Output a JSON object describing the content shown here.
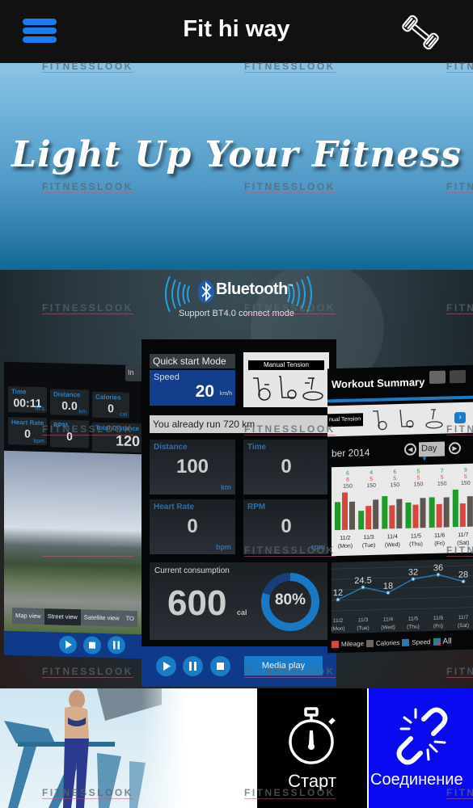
{
  "header": {
    "title": "Fit hi way",
    "menu_icon": "hamburger-menu-icon",
    "right_icon": "dumbbell-icon",
    "accent_color": "#1a7cf0"
  },
  "hero": {
    "slogan": "Light Up Your Fitness"
  },
  "promo": {
    "bluetooth_label": "Bluetooth",
    "bluetooth_tm": "™",
    "bluetooth_subtitle": "Support BT4.0 connect mode",
    "left_screen": {
      "top_button_partial": "In",
      "metrics": [
        {
          "label": "Time",
          "value": "00:11",
          "unit": "m:s"
        },
        {
          "label": "Distance",
          "value": "0.0",
          "unit": "km"
        },
        {
          "label": "Calories",
          "value": "0",
          "unit": "cal"
        },
        {
          "label": "Heart Rate",
          "value": "0",
          "unit": "bpm"
        },
        {
          "label": "RPM",
          "value": "0",
          "unit": ""
        },
        {
          "label": "Total Distance",
          "value": "120",
          "unit": ""
        }
      ],
      "view_tabs": [
        {
          "label": "Map view",
          "active": false
        },
        {
          "label": "Street view",
          "active": true
        },
        {
          "label": "Satellite view",
          "active": false
        },
        {
          "label": "TO",
          "active": false
        }
      ],
      "controls": [
        "play-icon",
        "stop-icon",
        "pause-icon"
      ]
    },
    "center_screen": {
      "mode_label": "Quick start Mode",
      "speed_label": "Speed",
      "speed_value": "20",
      "speed_unit": "km/h",
      "tension_label": "Manual Tension",
      "run_message": "You already run 720 km",
      "metrics": [
        {
          "label": "Distance",
          "value": "100",
          "unit": "km"
        },
        {
          "label": "Time",
          "value": "0",
          "unit": ""
        },
        {
          "label": "Heart Rate",
          "value": "0",
          "unit": "bpm"
        },
        {
          "label": "RPM",
          "value": "0",
          "unit": "rpm"
        }
      ],
      "consumption_label": "Current consumption",
      "consumption_value": "600",
      "consumption_unit": "cal",
      "progress_percent": 80,
      "progress_text": "80%",
      "controls": [
        "play-icon",
        "pause-icon",
        "stop-icon"
      ],
      "media_button": "Media play"
    },
    "right_screen": {
      "title": "Workout Summary",
      "tension_label": "nual Tension",
      "date_label": "ber 2014",
      "period_select": "Day",
      "bar_chart": {
        "categories": [
          "11/2",
          "11/3",
          "11/4",
          "11/5",
          "11/6",
          "11/7"
        ],
        "weekdays": [
          "(Mon)",
          "(Tue)",
          "(Wed)",
          "(Thu)",
          "(Fri)",
          "(Sat)"
        ],
        "top_labels": [
          "6",
          "4",
          "6",
          "5",
          "7",
          "9"
        ],
        "mid_labels": [
          "8",
          "5",
          "5",
          "5",
          "5",
          "5"
        ],
        "bottom_labels": [
          "150",
          "150",
          "150",
          "150",
          "150",
          "150"
        ],
        "series": [
          {
            "name": "green",
            "color": "#1f9a2a",
            "values": [
              6,
              4,
              7,
              5.5,
              6.5,
              8
            ]
          },
          {
            "name": "red",
            "color": "#d8453b",
            "values": [
              8,
              5,
              5,
              5,
              5,
              5
            ]
          },
          {
            "name": "gray",
            "color": "#5d5550",
            "values": [
              6,
              6.3,
              6.3,
              6.4,
              6.4,
              6.5
            ]
          }
        ]
      },
      "line_chart": {
        "categories": [
          "11/2",
          "11/3",
          "11/4",
          "11/5",
          "11/6",
          "11/7"
        ],
        "weekdays": [
          "(Mon)",
          "(Tue)",
          "(Wed)",
          "(Thu)",
          "(Fri)",
          "(Sat)"
        ],
        "values": [
          12,
          24.5,
          18,
          32,
          36,
          28
        ],
        "labels": [
          "12",
          "24.5",
          "18",
          "32",
          "36",
          "28"
        ],
        "ylim": [
          0,
          45
        ]
      },
      "legend": [
        {
          "label": "Mileage",
          "color": "#d8453b"
        },
        {
          "label": "Calories",
          "color": "#6e665e"
        },
        {
          "label": "Speed",
          "color": "#2a78b0"
        },
        {
          "label": "All",
          "color": "multi"
        }
      ]
    }
  },
  "bottom": {
    "start_label": "Старт",
    "start_icon": "stopwatch-icon",
    "connect_label": "Соединение",
    "connect_icon": "broken-link-icon",
    "connect_color": "#0a0af0"
  },
  "watermark": "FITNESSLOOK"
}
